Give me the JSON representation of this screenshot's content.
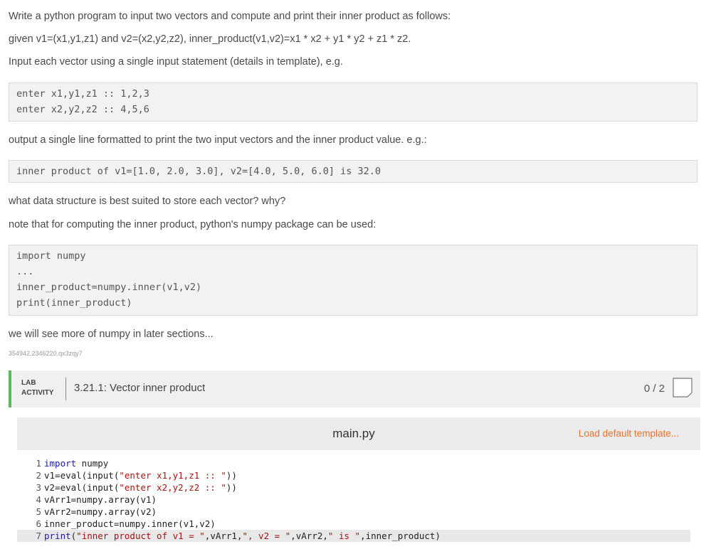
{
  "intro": {
    "line1": "Write a python program to input two vectors and compute and print their inner product as follows:",
    "line2": "given v1=(x1,y1,z1) and v2=(x2,y2,z2), inner_product(v1,v2)=x1 * x2 + y1 * y2 + z1 * z2.",
    "line3": "Input each vector using a single input statement (details in template), e.g."
  },
  "example_input": [
    "enter x1,y1,z1 :: 1,2,3",
    "enter x2,y2,z2 :: 4,5,6"
  ],
  "output_text": "output a single line formatted to print the two input vectors and the inner product value. e.g.:",
  "example_output": "inner product of v1=[1.0, 2.0, 3.0], v2=[4.0, 5.0, 6.0] is 32.0",
  "question1": "what data structure is best suited to store each vector? why?",
  "question2": "note that for computing the inner product, python's numpy package can be used:",
  "numpy_example": [
    "import numpy",
    "...",
    "inner_product=numpy.inner(v1,v2)",
    "print(inner_product)"
  ],
  "later_note": "we will see more of numpy in later sections...",
  "tracking_id": "354942.2346220.qx3zqy7",
  "lab": {
    "type_line1": "LAB",
    "type_line2": "ACTIVITY",
    "title": "3.21.1: Vector inner product",
    "score": "0 / 2"
  },
  "editor": {
    "filename": "main.py",
    "load_template": "Load default template...",
    "lines": [
      {
        "num": "1",
        "code": "import numpy"
      },
      {
        "num": "2",
        "code": "v1=eval(input(\"enter x1,y1,z1 :: \"))"
      },
      {
        "num": "3",
        "code": "v2=eval(input(\"enter x2,y2,z2 :: \"))"
      },
      {
        "num": "4",
        "code": "vArr1=numpy.array(v1)"
      },
      {
        "num": "5",
        "code": "vArr2=numpy.array(v2)"
      },
      {
        "num": "6",
        "code": "inner_product=numpy.inner(v1,v2)"
      },
      {
        "num": "7",
        "code": "print(\"inner product of v1 = \",vArr1,\", v2 = \",vArr2,\" is \",inner_product)"
      }
    ]
  },
  "colors": {
    "accent_green": "#5fb85f",
    "link_orange": "#e8712b"
  }
}
